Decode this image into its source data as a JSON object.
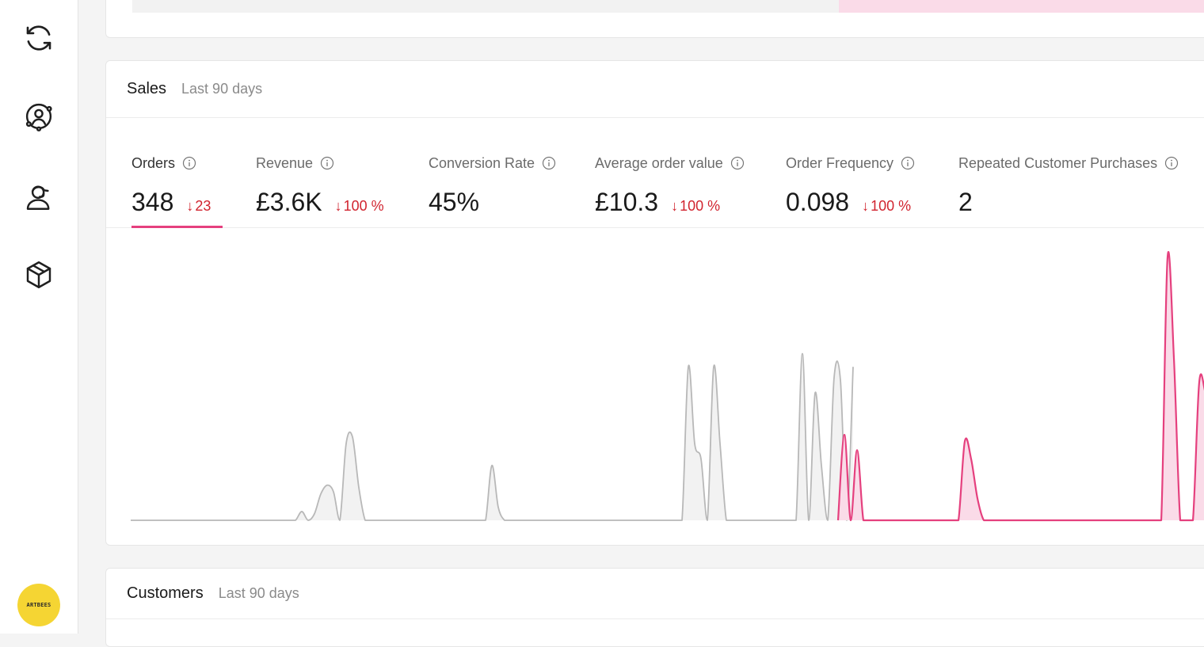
{
  "sidebar": {
    "items": [
      {
        "icon": "refresh-icon",
        "label": "Sync"
      },
      {
        "icon": "customer-orbit-icon",
        "label": "Customers"
      },
      {
        "icon": "support-agent-icon",
        "label": "Support"
      },
      {
        "icon": "package-icon",
        "label": "Products"
      }
    ],
    "avatar_text": "ARTBEES"
  },
  "sales": {
    "title": "Sales",
    "period": "Last 90 days",
    "metrics": [
      {
        "label": "Orders",
        "value": "348",
        "delta": "23",
        "active": true
      },
      {
        "label": "Revenue",
        "value": "£3.6K",
        "delta": "100 %"
      },
      {
        "label": "Conversion Rate",
        "value": "45%",
        "delta": ""
      },
      {
        "label": "Average order value",
        "value": "£10.3",
        "delta": "100 %"
      },
      {
        "label": "Order Frequency",
        "value": "0.098",
        "delta": "100 %"
      },
      {
        "label": "Repeated Customer Purchases",
        "value": "2",
        "delta": ""
      }
    ]
  },
  "customers": {
    "title": "Customers",
    "period": "Last 90 days"
  },
  "colors": {
    "accent": "#e5407e",
    "accent_fill": "#fadbe8",
    "previous_line": "#b8b8b8",
    "previous_fill": "#f2f2f2",
    "negative": "#d1242f"
  },
  "chart_data": {
    "type": "area",
    "series": [
      {
        "values": [
          0,
          0,
          0,
          0,
          0,
          0,
          0,
          0,
          0,
          0,
          0,
          0,
          0,
          0,
          0,
          0,
          0,
          0,
          0,
          0,
          0,
          0,
          0,
          0,
          0,
          0,
          0,
          0.4,
          0,
          0.3,
          1.2,
          1.6,
          1.3,
          0,
          3.5,
          3.8,
          1.5,
          0,
          0,
          0,
          0,
          0,
          0,
          0,
          0,
          0,
          0,
          0,
          0,
          0,
          0,
          0,
          0,
          0,
          0,
          0,
          0,
          2.5,
          0.6,
          0,
          0,
          0,
          0,
          0,
          0,
          0,
          0,
          0,
          0,
          0,
          0,
          0,
          0,
          0,
          0,
          0,
          0,
          0,
          0,
          0,
          0,
          0,
          0,
          0,
          0,
          0,
          0,
          0,
          7.0,
          3.5,
          2.8,
          0,
          7.0,
          3.5,
          0,
          0,
          0,
          0,
          0,
          0,
          0,
          0,
          0,
          0,
          0,
          0,
          7.6,
          0,
          5.8,
          2.5,
          0,
          6.5,
          6.4,
          0,
          7.0
        ]
      },
      {
        "values": [
          0,
          3.9,
          0,
          3.2,
          0,
          0,
          0,
          0,
          0,
          0,
          0,
          0,
          0,
          0,
          0,
          0,
          0,
          0,
          0,
          0,
          3.6,
          2.8,
          1.0,
          0,
          0,
          0,
          0,
          0,
          0,
          0,
          0,
          0,
          0,
          0,
          0,
          0,
          0,
          0,
          0,
          0,
          0,
          0,
          0,
          0,
          0,
          0,
          0,
          0,
          0,
          0,
          0,
          0,
          12.0,
          7.4,
          0,
          0,
          0,
          6.3,
          5.8,
          5.0,
          6.3,
          5.2,
          5.2,
          0,
          7.5,
          9.6,
          4.9,
          6.0,
          0,
          0,
          0,
          7.1,
          0,
          0,
          0,
          6.9,
          0,
          0,
          6.9,
          0,
          7.6,
          6.6
        ]
      }
    ],
    "ylim": [
      0,
      13
    ]
  }
}
